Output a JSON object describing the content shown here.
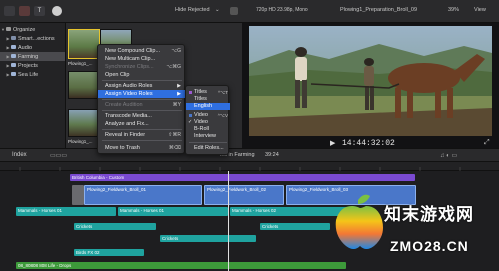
{
  "toolbar": {
    "hide_rejected": "Hide Rejected",
    "format": "720p HD 23.98p, Mono",
    "project_name": "Plowing1_Preparation_Broll_09",
    "zoom": "39%",
    "view": "View"
  },
  "sidebar": {
    "items": [
      {
        "label": "Organize",
        "expanded": true
      },
      {
        "label": "Smart...ections",
        "expanded": false
      },
      {
        "label": "Audio",
        "expanded": false
      },
      {
        "label": "Farming",
        "expanded": false
      },
      {
        "label": "Projects",
        "expanded": false
      },
      {
        "label": "Sea Life",
        "expanded": false
      }
    ]
  },
  "browser": {
    "clip_labels": [
      "Plowing1_...",
      "Plowing1_..."
    ]
  },
  "context_menu": {
    "items": [
      {
        "label": "New Compound Clip...",
        "shortcut": "⌥G"
      },
      {
        "label": "New Multicam Clip...",
        "shortcut": ""
      },
      {
        "label": "Synchronize Clips...",
        "shortcut": "⌥⌘G"
      },
      {
        "label": "Open Clip",
        "shortcut": ""
      },
      {
        "label": "Assign Audio Roles",
        "shortcut": ""
      },
      {
        "label": "Assign Video Roles",
        "shortcut": ""
      },
      {
        "label": "Create Audition",
        "shortcut": "⌘Y"
      },
      {
        "label": "Transcode Media...",
        "shortcut": ""
      },
      {
        "label": "Analyze and Fix...",
        "shortcut": ""
      },
      {
        "label": "Reveal in Finder",
        "shortcut": "⇧⌘R"
      },
      {
        "label": "Move to Trash",
        "shortcut": "⌘⌫"
      }
    ]
  },
  "submenu": {
    "items": [
      {
        "label": "Titles",
        "shortcut": "^⌥T"
      },
      {
        "label": "Titles",
        "shortcut": ""
      },
      {
        "label": "English",
        "shortcut": ""
      },
      {
        "label": "Video",
        "shortcut": "^⌥V"
      },
      {
        "label": "Video",
        "shortcut": ""
      },
      {
        "label": "B-Roll",
        "shortcut": ""
      },
      {
        "label": "Interview",
        "shortcut": ""
      },
      {
        "label": "Edit Roles...",
        "shortcut": ""
      }
    ]
  },
  "viewer": {
    "timecode": "14:44:32:02"
  },
  "timeline_bar": {
    "index_label": "Index",
    "project_label": "les in Farming",
    "duration": "39:24"
  },
  "timeline": {
    "clips": [
      {
        "label": "British Columbia - Custom"
      },
      {
        "label": "Plowing2_Fieldwork_Broll_01"
      },
      {
        "label": "Plowing2_Fieldwork_Broll_02"
      },
      {
        "label": "Plowing2_Fieldwork_Broll_03"
      },
      {
        "label": "Mammals - Horses 01"
      },
      {
        "label": "Mammals - Horses 01"
      },
      {
        "label": "Mammals - Horses 02"
      },
      {
        "label": "Crickets"
      },
      {
        "label": "Crickets"
      },
      {
        "label": "Crickets"
      },
      {
        "label": "Birds FX 02"
      },
      {
        "label": "08_80808 808 Life - Drops"
      }
    ]
  },
  "watermark": {
    "title": "知末游戏网",
    "url": "ZMO28.CN"
  },
  "colors": {
    "highlight": "#2f6fe0",
    "selection": "#e6c42d",
    "title_clip": "#7a4ad1",
    "video_clip": "#4a77c9",
    "audio_clip": "#1fa39f",
    "music_clip": "#3d9a3a"
  }
}
